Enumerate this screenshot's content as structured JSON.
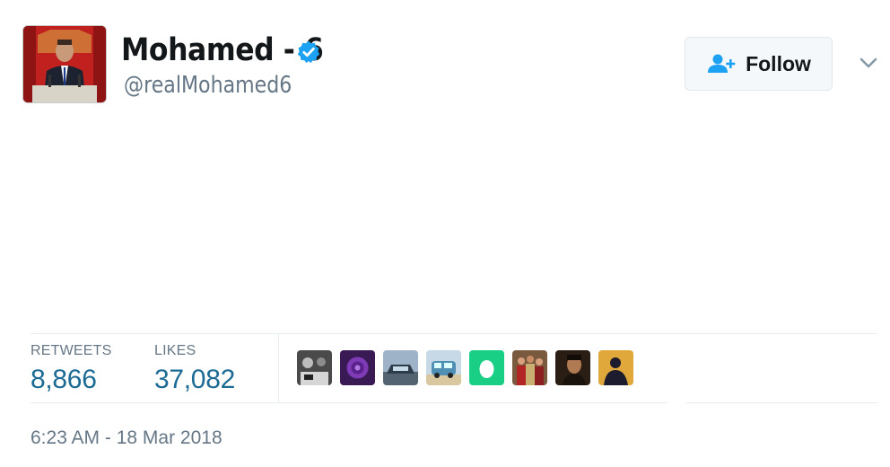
{
  "profile": {
    "display_name": "Mohamed - 6",
    "handle": "@realMohamed6",
    "verified_color": "#1da1f2"
  },
  "follow_button": {
    "label": "Follow",
    "icon": "add-user-icon",
    "icon_color": "#1da1f2"
  },
  "menu": {
    "icon": "chevron-down-icon"
  },
  "stats": {
    "retweets_label": "RETWEETS",
    "retweets_value": "8,866",
    "likes_label": "LIKES",
    "likes_value": "37,082"
  },
  "likers": [
    {
      "icon": "avatar-bw-photo"
    },
    {
      "icon": "avatar-purple-rose"
    },
    {
      "icon": "avatar-car"
    },
    {
      "icon": "avatar-van"
    },
    {
      "icon": "avatar-default-egg"
    },
    {
      "icon": "avatar-group-photo"
    },
    {
      "icon": "avatar-portrait-dark"
    },
    {
      "icon": "avatar-silhouette"
    }
  ],
  "timestamp": "6:23 AM - 18 Mar 2018",
  "colors": {
    "value_blue": "#1c6b94",
    "muted": "#657786",
    "divider": "#e6ecf0"
  }
}
